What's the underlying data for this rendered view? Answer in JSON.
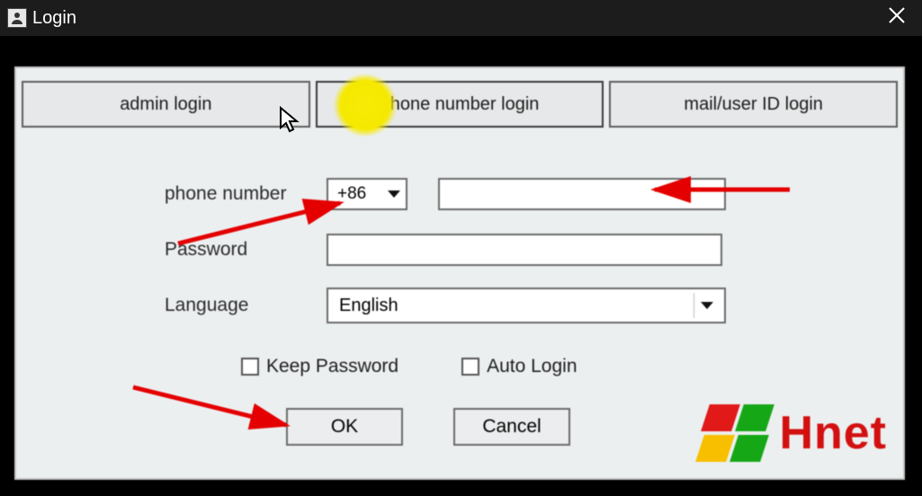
{
  "window": {
    "title": "Login"
  },
  "tabs": {
    "admin": "admin login",
    "phone": "phone number login",
    "mail": "mail/user ID login"
  },
  "form": {
    "phone_label": "phone number",
    "country_code": "+86",
    "phone_value": "",
    "password_label": "Password",
    "password_value": "",
    "language_label": "Language",
    "language_value": "English"
  },
  "checks": {
    "keep_password": "Keep Password",
    "auto_login": "Auto Login"
  },
  "buttons": {
    "ok": "OK",
    "cancel": "Cancel"
  },
  "logo": {
    "text": "Hnet"
  }
}
